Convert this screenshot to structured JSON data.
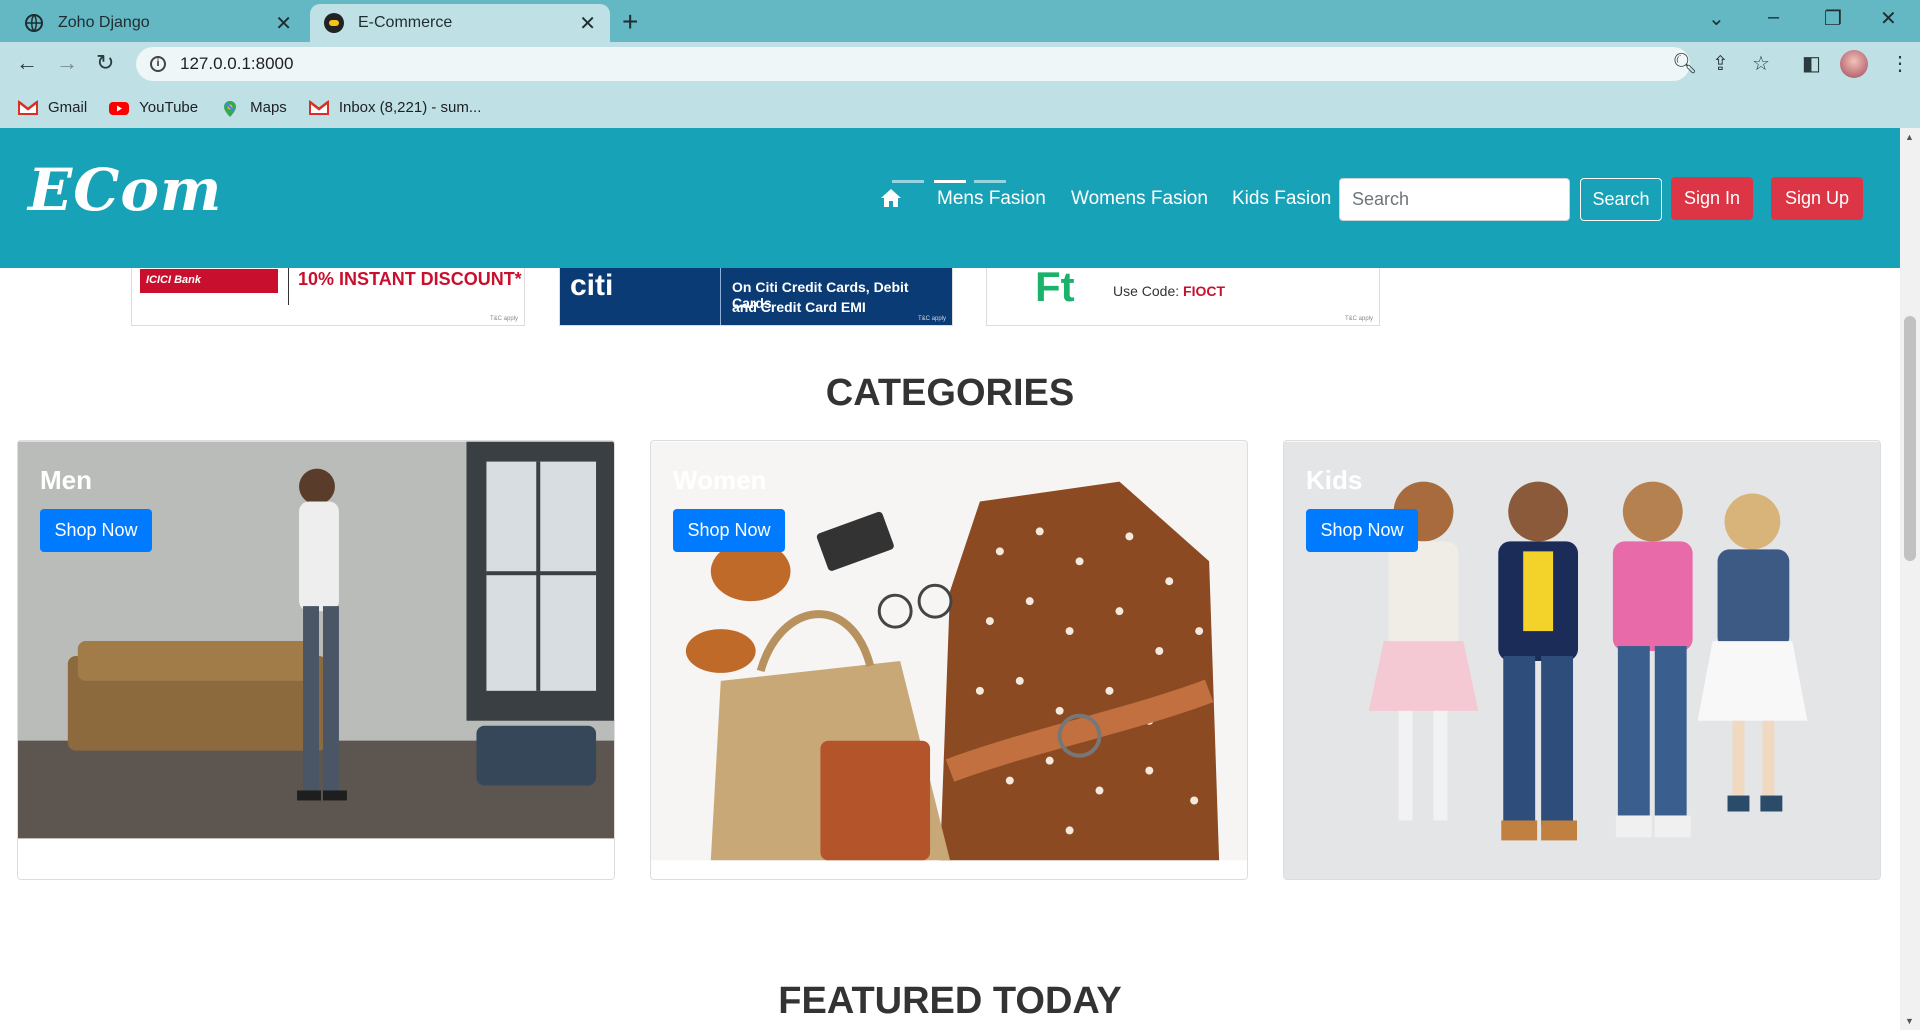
{
  "browser": {
    "tabs": [
      {
        "title": "Zoho Django",
        "active": false
      },
      {
        "title": "E-Commerce",
        "active": true
      }
    ],
    "address": "127.0.0.1:8000",
    "bookmarks": [
      {
        "label": "Gmail",
        "icon": "gmail-icon"
      },
      {
        "label": "YouTube",
        "icon": "youtube-icon"
      },
      {
        "label": "Maps",
        "icon": "maps-icon"
      },
      {
        "label": "Inbox (8,221) - sum...",
        "icon": "gmail-icon"
      }
    ]
  },
  "navbar": {
    "brand": "ECom",
    "links": [
      "Mens Fasion",
      "Womens Fasion",
      "Kids Fasion"
    ],
    "search_placeholder": "Search",
    "search_button": "Search",
    "sign_in": "Sign In",
    "sign_up": "Sign Up",
    "color": "#17a2b8"
  },
  "offers": [
    {
      "bank": "ICICI Bank",
      "text": "10% INSTANT DISCOUNT*",
      "note": "T&C apply"
    },
    {
      "bank": "citi",
      "line1": "On Citi Credit Cards, Debit Cards",
      "line2": "and Credit Card EMI",
      "note": "T&C apply"
    },
    {
      "bank": "Ft",
      "text": "Use Code:",
      "code": "FIOCT",
      "note": "T&C apply"
    }
  ],
  "sections": {
    "categories": "CATEGORIES",
    "featured": "FEATURED TODAY"
  },
  "categories": [
    {
      "title": "Men",
      "button": "Shop Now"
    },
    {
      "title": "Women",
      "button": "Shop Now"
    },
    {
      "title": "Kids",
      "button": "Shop Now"
    }
  ]
}
